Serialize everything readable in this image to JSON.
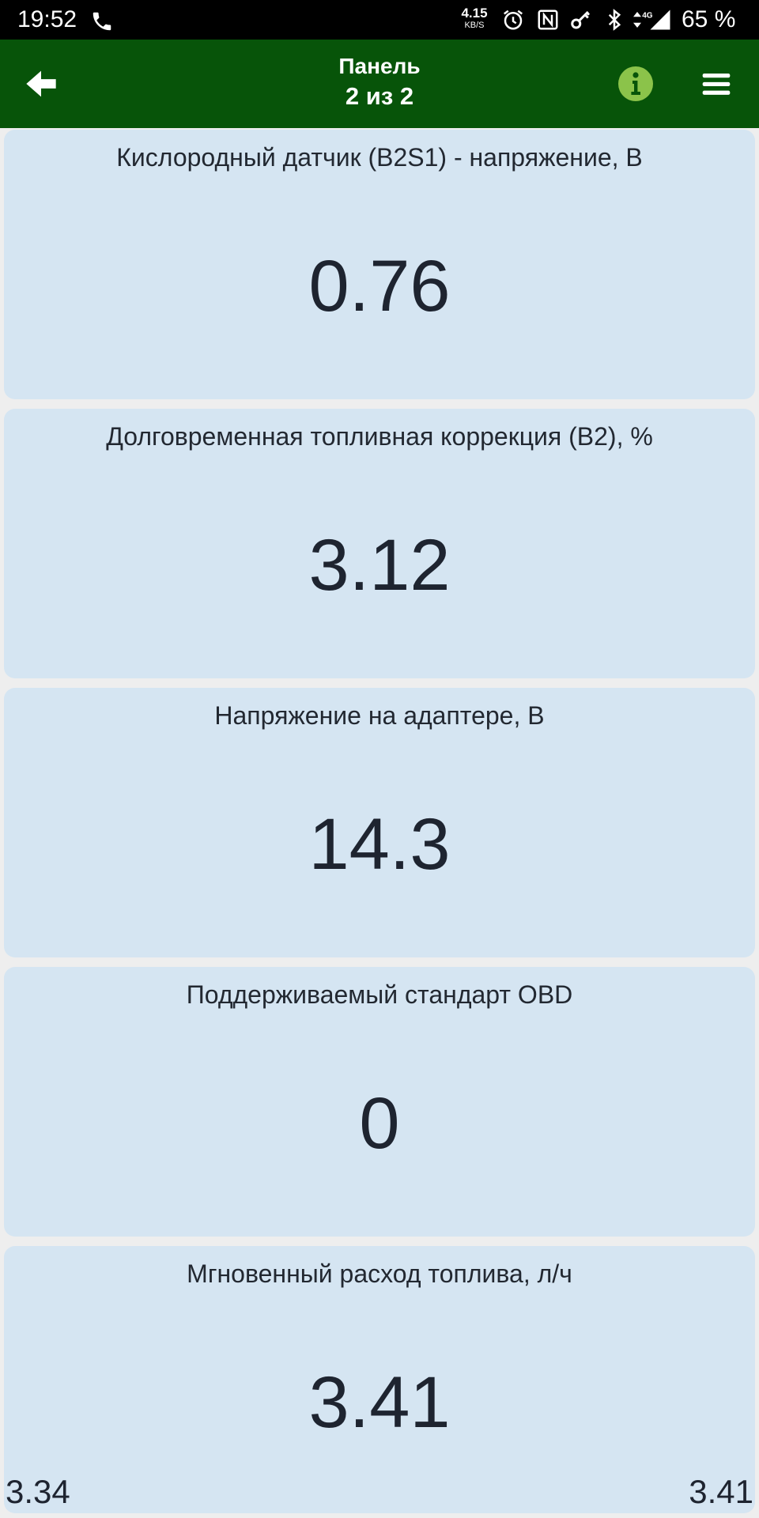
{
  "status_bar": {
    "time": "19:52",
    "net_speed_value": "4.15",
    "net_speed_unit": "KB/S",
    "network_type": "4G",
    "battery": "65 %",
    "icons": [
      "phone-icon",
      "alarm-icon",
      "nfc-icon",
      "key-icon",
      "bluetooth-icon",
      "data-arrows-icon",
      "signal-icon"
    ]
  },
  "app_bar": {
    "title": "Панель",
    "subtitle": "2 из 2",
    "icons": [
      "back-arrow-icon",
      "info-icon",
      "menu-icon"
    ],
    "accent_color": "#075409",
    "info_icon_color": "#8bc34a"
  },
  "gauges": [
    {
      "label": "Кислородный датчик (B2S1) - напряжение, В",
      "value": "0.76"
    },
    {
      "label": "Долговременная топливная коррекция (B2), %",
      "value": "3.12"
    },
    {
      "label": "Напряжение на адаптере, В",
      "value": "14.3"
    },
    {
      "label": "Поддерживаемый стандарт OBD",
      "value": "0"
    },
    {
      "label": "Мгновенный расход топлива, л/ч",
      "value": "3.41",
      "min": "3.34",
      "max": "3.41"
    }
  ],
  "colors": {
    "card_background": "#d5e5f2",
    "page_background": "#eeeeee",
    "text": "#1e2430"
  }
}
